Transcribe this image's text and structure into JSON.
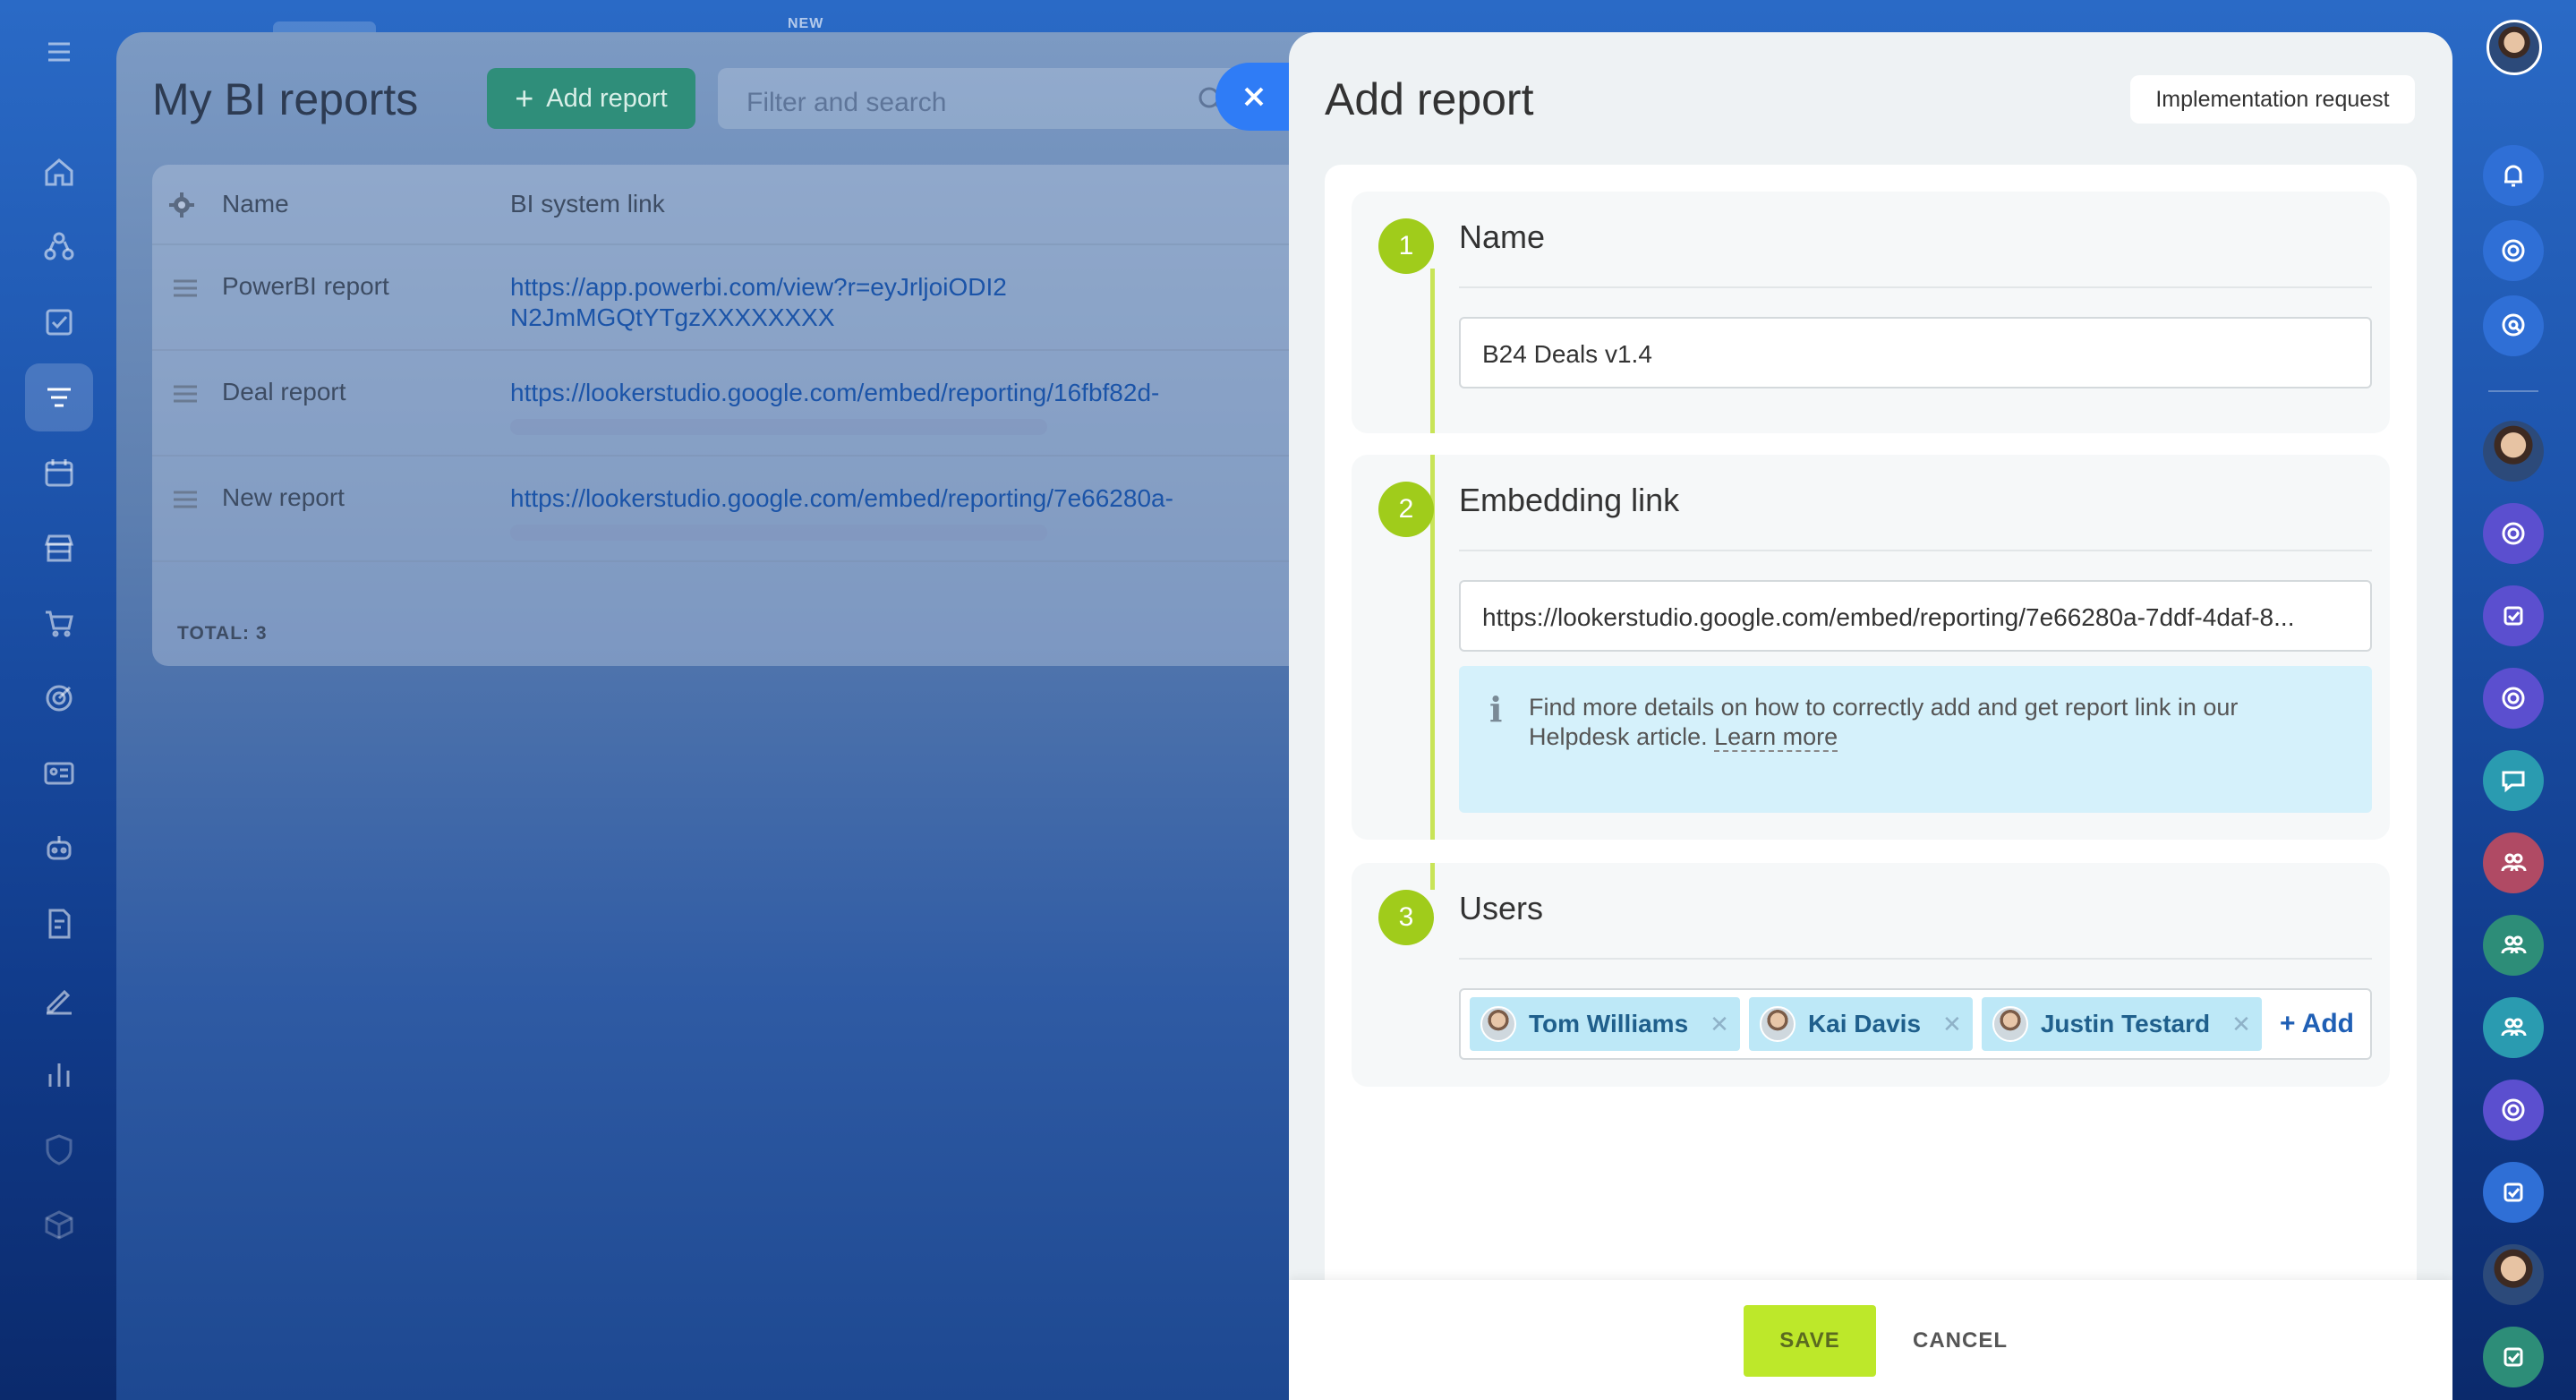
{
  "top": {
    "new_badge": "NEW"
  },
  "reports_page": {
    "title": "My BI reports",
    "add_report_label": "Add report",
    "filter_placeholder": "Filter and search",
    "columns": {
      "name": "Name",
      "link": "BI system link"
    },
    "rows": [
      {
        "name": "PowerBI report",
        "link": "https://app.powerbi.com/view?r=eyJrljoiODI2N2JmMGQtYTgzXXXXXXXX"
      },
      {
        "name": "Deal report",
        "link": "https://lookerstudio.google.com/embed/reporting/16fbf82d-"
      },
      {
        "name": "New report",
        "link": "https://lookerstudio.google.com/embed/reporting/7e66280a-"
      }
    ],
    "total_label": "TOTAL:",
    "total_value": "3"
  },
  "slider": {
    "title": "Add report",
    "implementation_request": "Implementation request",
    "steps": [
      {
        "number": "1",
        "title": "Name",
        "value": "B24 Deals v1.4"
      },
      {
        "number": "2",
        "title": "Embedding link",
        "value": "https://lookerstudio.google.com/embed/reporting/7e66280a-7ddf-4daf-8...",
        "info_text": "Find more details on how to correctly add and get report link in our Helpdesk article.",
        "learn_more": "Learn more"
      },
      {
        "number": "3",
        "title": "Users",
        "users": [
          "Tom Williams",
          "Kai Davis",
          "Justin Testard"
        ],
        "add_label": "+ Add"
      }
    ],
    "save_label": "SAVE",
    "cancel_label": "CANCEL"
  },
  "colors": {
    "accent_green": "#a0cc1b",
    "save_button": "#bde82a",
    "link_blue": "#1b54a8",
    "close_button": "#2f7cf6"
  },
  "icons": {
    "left_rail": [
      "menu-icon",
      "home-icon",
      "crm-icon",
      "tasks-icon",
      "feed-icon",
      "calendar-icon",
      "store-icon",
      "cart-icon",
      "target-icon",
      "contact-card-icon",
      "robot-icon",
      "document-sign-icon",
      "signature-icon",
      "analytics-icon",
      "shield-icon",
      "box-icon"
    ],
    "right_rail": [
      "notifications-icon",
      "copilot-icon",
      "chat-search-icon"
    ]
  }
}
